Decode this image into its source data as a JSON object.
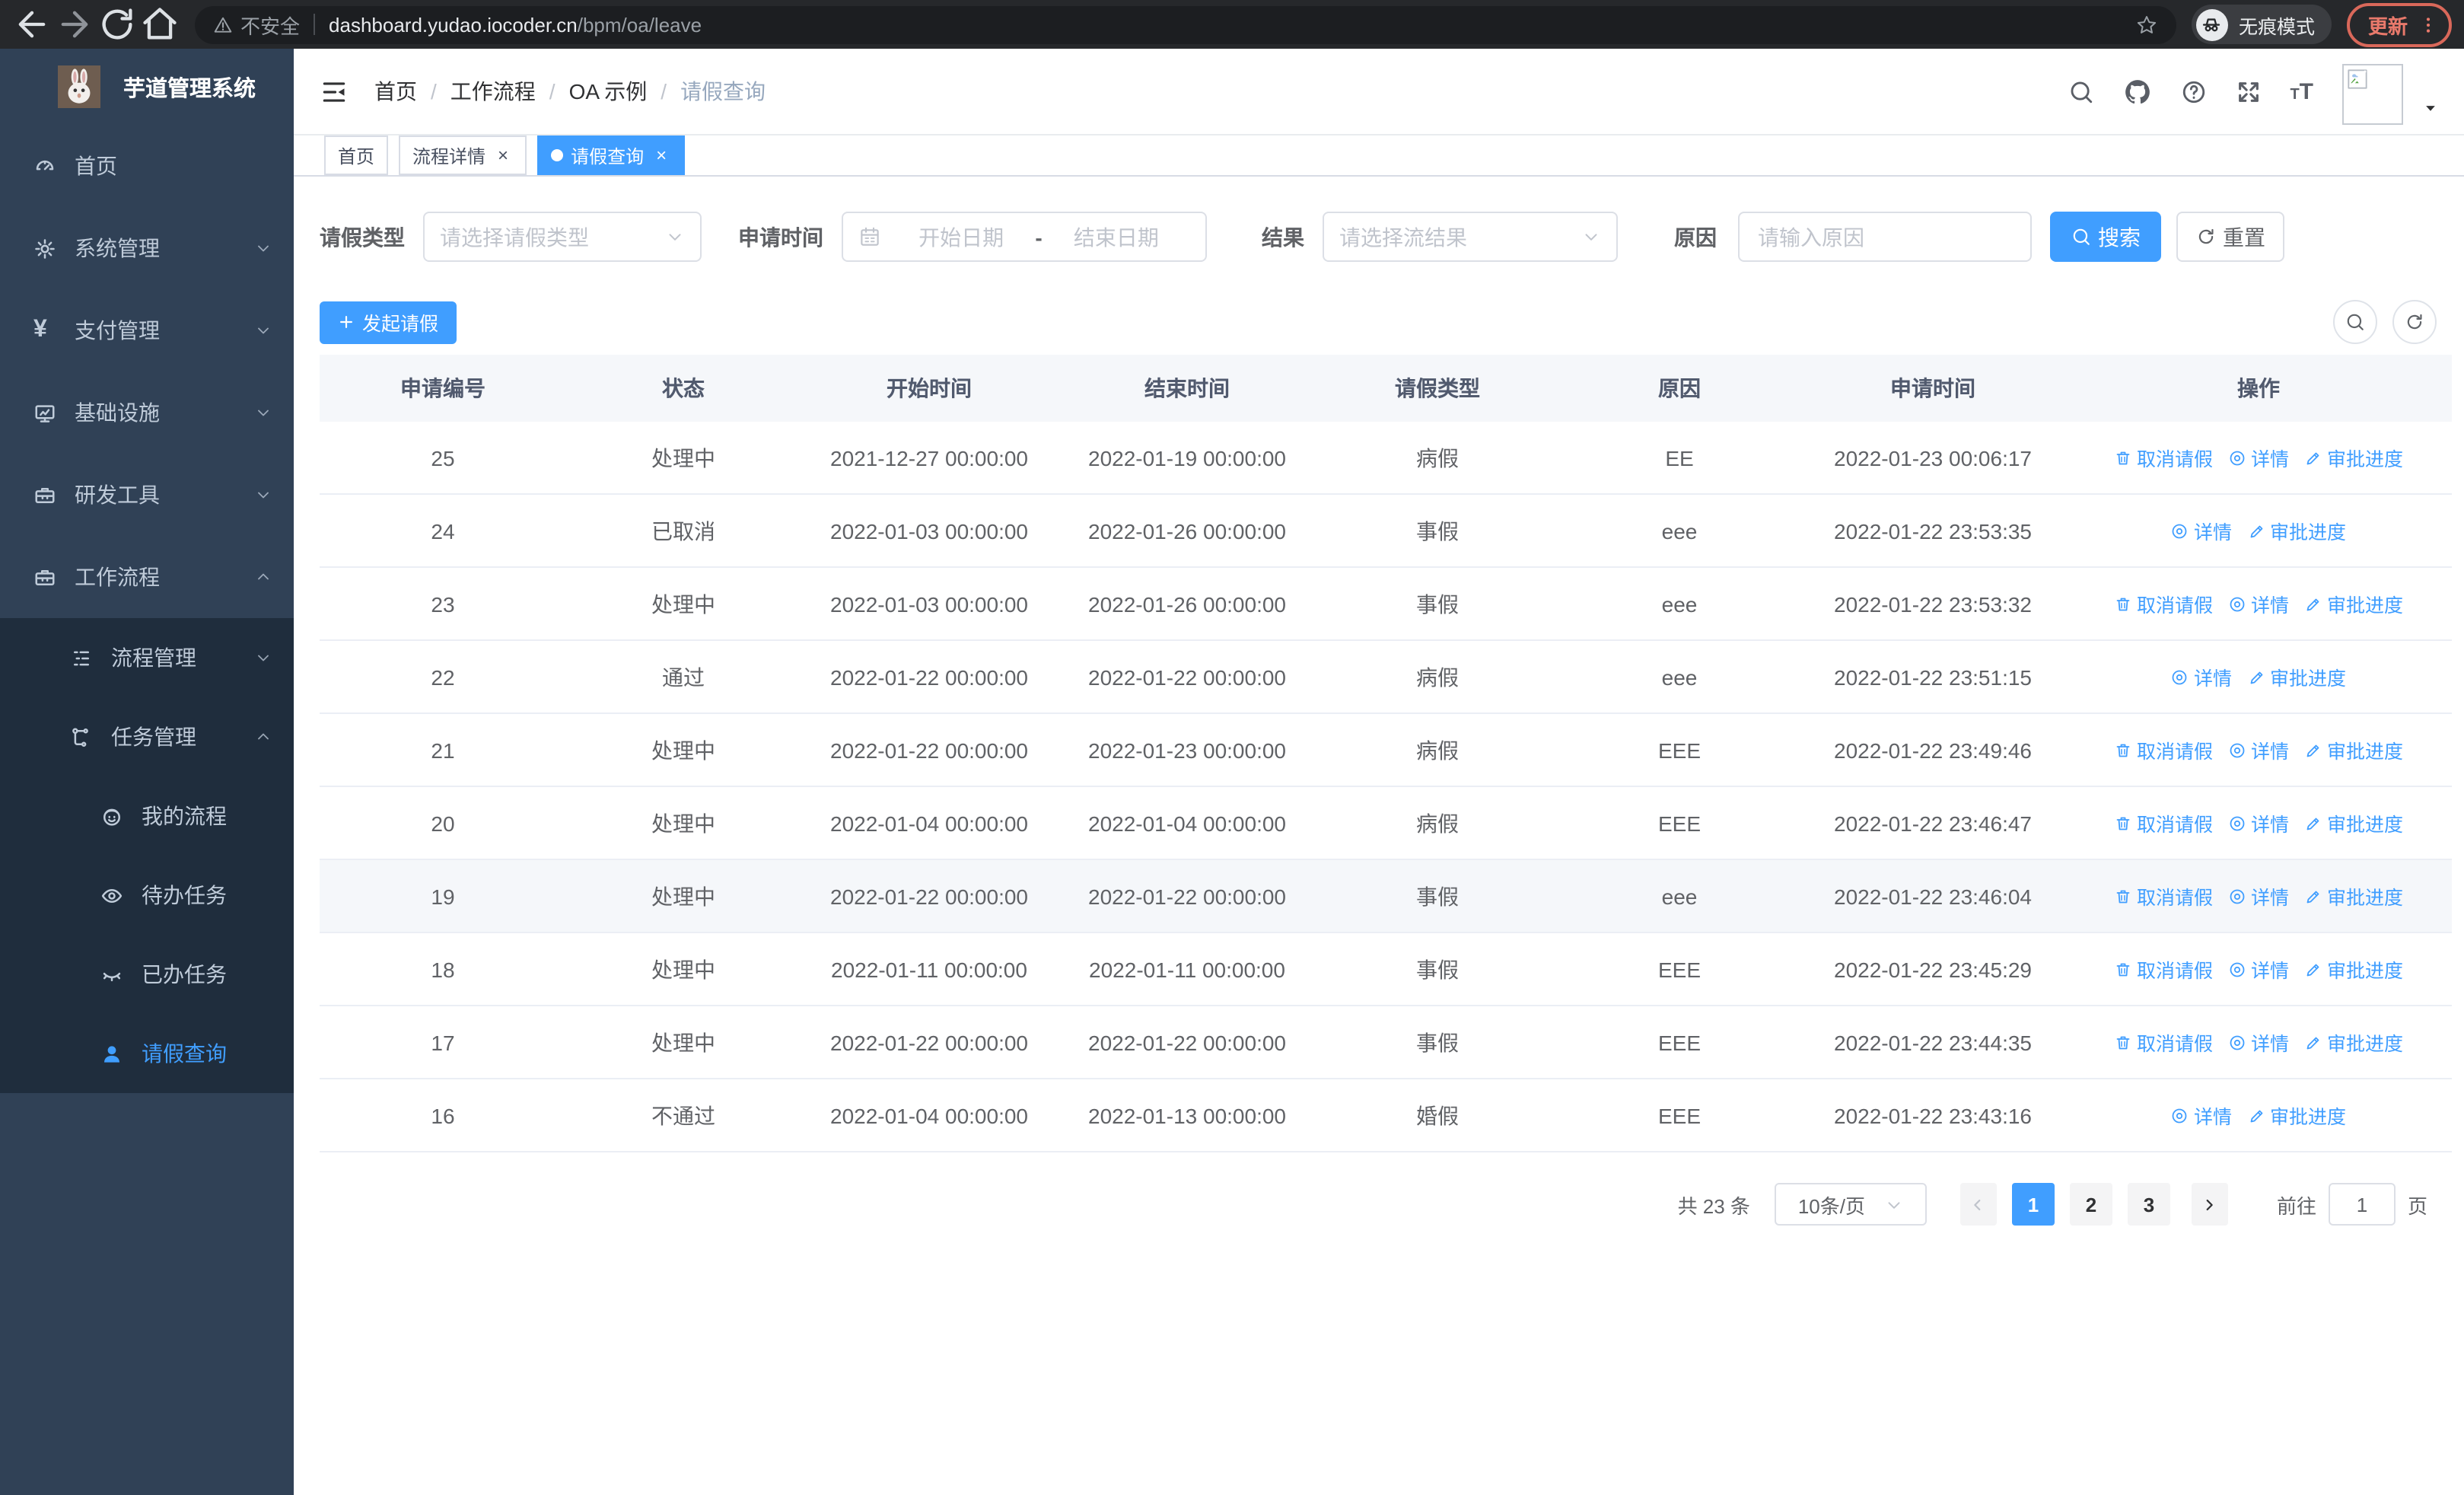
{
  "browser": {
    "security_label": "不安全",
    "url_host": "dashboard.yudao.iocoder.cn",
    "url_path": "/bpm/oa/leave",
    "incognito_label": "无痕模式",
    "update_label": "更新"
  },
  "sidebar": {
    "app_title": "芋道管理系统",
    "items": [
      {
        "id": "home",
        "label": "首页",
        "icon": "gauge",
        "level": 1,
        "chevron": "",
        "submenu": false,
        "active": false
      },
      {
        "id": "system-mgmt",
        "label": "系统管理",
        "icon": "gear",
        "level": 1,
        "chevron": "down",
        "submenu": false,
        "active": false
      },
      {
        "id": "pay-mgmt",
        "label": "支付管理",
        "icon": "yen",
        "level": 1,
        "chevron": "down",
        "submenu": false,
        "active": false
      },
      {
        "id": "infrastructure",
        "label": "基础设施",
        "icon": "monitor",
        "level": 1,
        "chevron": "down",
        "submenu": false,
        "active": false
      },
      {
        "id": "dev-tools",
        "label": "研发工具",
        "icon": "toolbox",
        "level": 1,
        "chevron": "down",
        "submenu": false,
        "active": false
      },
      {
        "id": "workflow",
        "label": "工作流程",
        "icon": "toolbox",
        "level": 1,
        "chevron": "up",
        "submenu": false,
        "active": false
      },
      {
        "id": "process-mgmt",
        "label": "流程管理",
        "icon": "tree-list",
        "level": 2,
        "chevron": "down",
        "submenu": true,
        "active": false
      },
      {
        "id": "task-mgmt",
        "label": "任务管理",
        "icon": "sitemap",
        "level": 2,
        "chevron": "up",
        "submenu": true,
        "active": false
      },
      {
        "id": "my-process",
        "label": "我的流程",
        "icon": "face",
        "level": 3,
        "chevron": "",
        "submenu": true,
        "active": false
      },
      {
        "id": "todo-task",
        "label": "待办任务",
        "icon": "eye",
        "level": 3,
        "chevron": "",
        "submenu": true,
        "active": false
      },
      {
        "id": "done-task",
        "label": "已办任务",
        "icon": "eye-closed",
        "level": 3,
        "chevron": "",
        "submenu": true,
        "active": false
      },
      {
        "id": "leave-query",
        "label": "请假查询",
        "icon": "user",
        "level": 3,
        "chevron": "",
        "submenu": true,
        "active": true
      }
    ]
  },
  "navbar": {
    "breadcrumb": [
      "首页",
      "工作流程",
      "OA 示例",
      "请假查询"
    ]
  },
  "tabs": [
    {
      "label": "首页",
      "closable": false,
      "active": false
    },
    {
      "label": "流程详情",
      "closable": true,
      "active": false
    },
    {
      "label": "请假查询",
      "closable": true,
      "active": true
    }
  ],
  "filters": {
    "type_label": "请假类型",
    "type_placeholder": "请选择请假类型",
    "time_label": "申请时间",
    "date_start_placeholder": "开始日期",
    "date_separator": "-",
    "date_end_placeholder": "结束日期",
    "result_label": "结果",
    "result_placeholder": "请选择流结果",
    "reason_label": "原因",
    "reason_placeholder": "请输入原因",
    "search_label": "搜索",
    "reset_label": "重置"
  },
  "toolbar": {
    "create_label": "发起请假"
  },
  "table": {
    "columns": [
      "申请编号",
      "状态",
      "开始时间",
      "结束时间",
      "请假类型",
      "原因",
      "申请时间",
      "操作"
    ],
    "action_labels": {
      "cancel": "取消请假",
      "detail": "详情",
      "progress": "审批进度"
    },
    "rows": [
      {
        "id": "25",
        "status": "处理中",
        "start": "2021-12-27 00:00:00",
        "end": "2022-01-19 00:00:00",
        "type": "病假",
        "reason": "EE",
        "apply_time": "2022-01-23 00:06:17",
        "actions": [
          "cancel",
          "detail",
          "progress"
        ],
        "highlighted": false
      },
      {
        "id": "24",
        "status": "已取消",
        "start": "2022-01-03 00:00:00",
        "end": "2022-01-26 00:00:00",
        "type": "事假",
        "reason": "eee",
        "apply_time": "2022-01-22 23:53:35",
        "actions": [
          "detail",
          "progress"
        ],
        "highlighted": false
      },
      {
        "id": "23",
        "status": "处理中",
        "start": "2022-01-03 00:00:00",
        "end": "2022-01-26 00:00:00",
        "type": "事假",
        "reason": "eee",
        "apply_time": "2022-01-22 23:53:32",
        "actions": [
          "cancel",
          "detail",
          "progress"
        ],
        "highlighted": false
      },
      {
        "id": "22",
        "status": "通过",
        "start": "2022-01-22 00:00:00",
        "end": "2022-01-22 00:00:00",
        "type": "病假",
        "reason": "eee",
        "apply_time": "2022-01-22 23:51:15",
        "actions": [
          "detail",
          "progress"
        ],
        "highlighted": false
      },
      {
        "id": "21",
        "status": "处理中",
        "start": "2022-01-22 00:00:00",
        "end": "2022-01-23 00:00:00",
        "type": "病假",
        "reason": "EEE",
        "apply_time": "2022-01-22 23:49:46",
        "actions": [
          "cancel",
          "detail",
          "progress"
        ],
        "highlighted": false
      },
      {
        "id": "20",
        "status": "处理中",
        "start": "2022-01-04 00:00:00",
        "end": "2022-01-04 00:00:00",
        "type": "病假",
        "reason": "EEE",
        "apply_time": "2022-01-22 23:46:47",
        "actions": [
          "cancel",
          "detail",
          "progress"
        ],
        "highlighted": false
      },
      {
        "id": "19",
        "status": "处理中",
        "start": "2022-01-22 00:00:00",
        "end": "2022-01-22 00:00:00",
        "type": "事假",
        "reason": "eee",
        "apply_time": "2022-01-22 23:46:04",
        "actions": [
          "cancel",
          "detail",
          "progress"
        ],
        "highlighted": true
      },
      {
        "id": "18",
        "status": "处理中",
        "start": "2022-01-11 00:00:00",
        "end": "2022-01-11 00:00:00",
        "type": "事假",
        "reason": "EEE",
        "apply_time": "2022-01-22 23:45:29",
        "actions": [
          "cancel",
          "detail",
          "progress"
        ],
        "highlighted": false
      },
      {
        "id": "17",
        "status": "处理中",
        "start": "2022-01-22 00:00:00",
        "end": "2022-01-22 00:00:00",
        "type": "事假",
        "reason": "EEE",
        "apply_time": "2022-01-22 23:44:35",
        "actions": [
          "cancel",
          "detail",
          "progress"
        ],
        "highlighted": false
      },
      {
        "id": "16",
        "status": "不通过",
        "start": "2022-01-04 00:00:00",
        "end": "2022-01-13 00:00:00",
        "type": "婚假",
        "reason": "EEE",
        "apply_time": "2022-01-22 23:43:16",
        "actions": [
          "detail",
          "progress"
        ],
        "highlighted": false
      }
    ]
  },
  "pagination": {
    "total_label": "共 23 条",
    "page_size": "10条/页",
    "pages": [
      "1",
      "2",
      "3"
    ],
    "active_page": "1",
    "goto_label": "前往",
    "goto_value": "1",
    "page_unit": "页"
  },
  "colors": {
    "primary": "#409eff",
    "sidebar_bg": "#304156",
    "submenu_bg": "#1f2d3d",
    "sidebar_text": "#bfcbd9",
    "table_header_bg": "#f5f7fa",
    "border": "#ebeef5",
    "update_accent": "#e8796b"
  }
}
